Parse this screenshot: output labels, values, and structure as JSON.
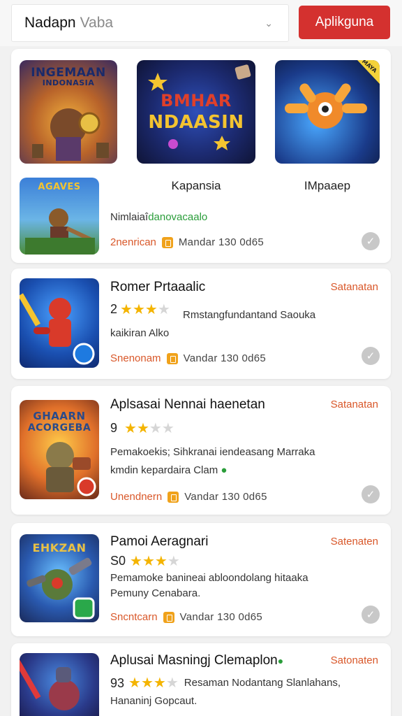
{
  "header": {
    "select_value": "Nadapn",
    "select_hint": "Vaba",
    "cta_label": "Aplikguna"
  },
  "featured": {
    "tile1_caption_top": "INGEMAAN",
    "tile1_caption_bottom": "INDONASIA",
    "tile2_caption_top": "BMHAR",
    "tile2_caption_bottom": "NDAASIN",
    "tile3_badge": "MAYA",
    "label2": "Kapansia",
    "label3": "IMpaaep",
    "tile4_caption": "AGAVES",
    "desc_a": "Nimlaiaî",
    "desc_b": "danovacaalo",
    "meta_label": "2nenrican",
    "meta_text": "Mandar   130   0d65"
  },
  "apps": [
    {
      "title": "Romer Prtaaalic",
      "tag": "Satanatan",
      "rating_num": "2",
      "stars": 3,
      "line1": "Rmstangfundantand Saouka",
      "line2": "kaikiran Alko",
      "meta_label": "Snenonam",
      "meta_text": "Vandar   130   0d65"
    },
    {
      "title": "Aplsasai Nennai haenetan",
      "tag": "Satanatan",
      "rating_num": "9",
      "stars": 2,
      "line1": "Pemakoekis; Sihkranai iendeasang Marraka",
      "line2": "kmdin kepardaira Clam",
      "meta_label": "Unendnern",
      "meta_text": "Vandar   130   0d65",
      "thumb_caption_top": "GHAARN",
      "thumb_caption_bottom": "ACORGEBA"
    },
    {
      "title": "Pamoi Aeragnari",
      "tag": "Satenaten",
      "rating_num": "S0",
      "stars": 3,
      "line1": "Pemamoke banineai abloondolang hitaaka",
      "line2": "Pemuny Cenabara.",
      "meta_label": "Sncntcarn",
      "meta_text": "Vandar   130   0d65",
      "thumb_caption": "EHKZAN"
    },
    {
      "title": "Aplusai Masningj Clemaplon",
      "tag": "Satonaten",
      "rating_num": "93",
      "stars": 3,
      "line1": "Resaman Nodantang Slanlahans,",
      "line2": "Hananinj Gopcaut."
    }
  ],
  "colors": {
    "accent": "#d4312f",
    "tag": "#d9582a",
    "star": "#f4b400"
  }
}
